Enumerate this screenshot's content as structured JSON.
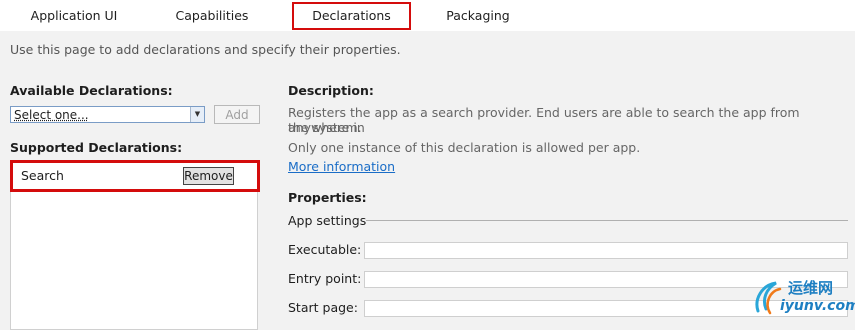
{
  "tabs": [
    {
      "label": "Application UI"
    },
    {
      "label": "Capabilities"
    },
    {
      "label": "Declarations",
      "active": true
    },
    {
      "label": "Packaging"
    }
  ],
  "subtitle": "Use this page to add declarations and specify their properties.",
  "available": {
    "heading": "Available Declarations:",
    "select_value": "Select one...",
    "add_label": "Add"
  },
  "supported": {
    "heading": "Supported Declarations:",
    "items": [
      {
        "name": "Search",
        "remove_label": "Remove"
      }
    ]
  },
  "description": {
    "heading": "Description:",
    "line1": "Registers the app as a search provider. End users are able to search the app from anywhere in",
    "line2": "the system.",
    "line3": "Only one instance of this declaration is allowed per app.",
    "more_info": "More information"
  },
  "properties": {
    "heading": "Properties:",
    "group": "App settings",
    "fields": [
      {
        "label": "Executable:",
        "value": ""
      },
      {
        "label": "Entry point:",
        "value": ""
      },
      {
        "label": "Start page:",
        "value": ""
      }
    ]
  },
  "watermark": {
    "cn": "运维网",
    "domain": "iyunv.com"
  },
  "colors": {
    "highlight": "#d40c0c",
    "link": "#1a6dc7"
  }
}
